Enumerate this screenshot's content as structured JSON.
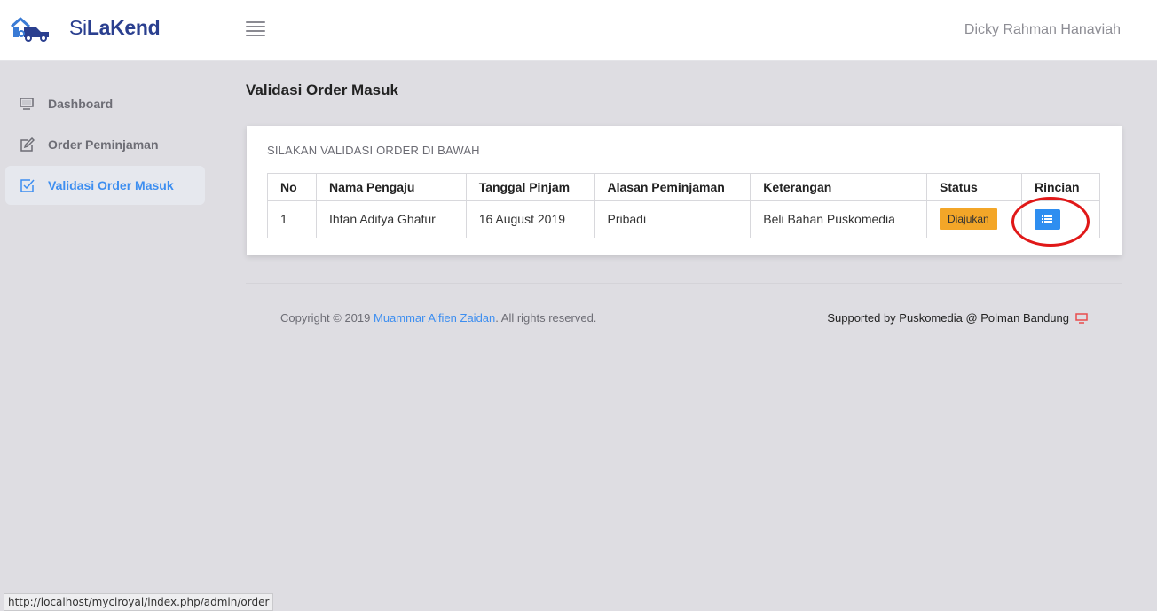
{
  "app": {
    "brand_light": "Si",
    "brand_bold": "LaKend"
  },
  "header": {
    "user_name": "Dicky Rahman Hanaviah"
  },
  "sidebar": {
    "items": [
      {
        "label": "Dashboard",
        "icon": "monitor-icon"
      },
      {
        "label": "Order Peminjaman",
        "icon": "edit-icon"
      },
      {
        "label": "Validasi Order Masuk",
        "icon": "checkbox-icon",
        "active": true
      }
    ]
  },
  "page": {
    "title": "Validasi Order Masuk"
  },
  "card": {
    "header": "SILAKAN VALIDASI ORDER DI BAWAH",
    "columns": [
      "No",
      "Nama Pengaju",
      "Tanggal Pinjam",
      "Alasan Peminjaman",
      "Keterangan",
      "Status",
      "Rincian"
    ],
    "rows": [
      {
        "no": "1",
        "nama": "Ihfan Aditya Ghafur",
        "tanggal": "16 August 2019",
        "alasan": "Pribadi",
        "keterangan": "Beli Bahan Puskomedia",
        "status": "Diajukan",
        "rincian_icon": "list-icon"
      }
    ]
  },
  "footer": {
    "copyright_prefix": "Copyright © 2019 ",
    "author": "Muammar Alfien Zaidan",
    "copyright_suffix": ". All rights reserved.",
    "supported": "Supported by Puskomedia @ Polman Bandung"
  },
  "statusbar": {
    "url": "http://localhost/myciroyal/index.php/admin/order"
  },
  "colors": {
    "brand": "#2a3f8f",
    "accent": "#3d8ef0",
    "badge": "#f3a628",
    "highlight": "#e01818"
  }
}
